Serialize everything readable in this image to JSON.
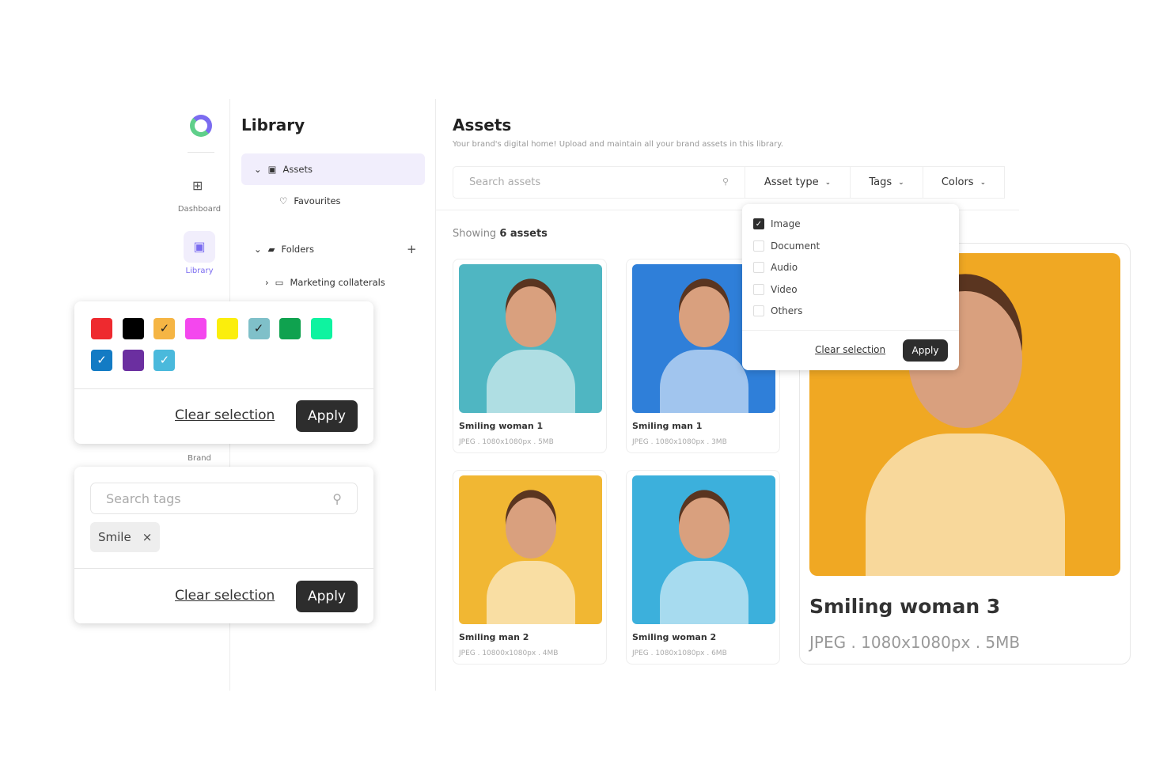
{
  "rail": {
    "items": [
      {
        "label": "Dashboard",
        "icon": "grid-icon"
      },
      {
        "label": "Library",
        "icon": "folder-image-icon",
        "active": true
      },
      {
        "label": "Brand"
      }
    ]
  },
  "library": {
    "title": "Library",
    "assets": "Assets",
    "favourites": "Favourites",
    "folders": "Folders",
    "marketing": "Marketing collaterals"
  },
  "main": {
    "title": "Assets",
    "subtitle": "Your brand's digital home! Upload and maintain all your brand assets in this library.",
    "search_placeholder": "Search assets",
    "filters": [
      "Asset type",
      "Tags",
      "Colors"
    ],
    "showing_prefix": "Showing",
    "showing_count": "6 assets"
  },
  "cards": [
    {
      "title": "Smiling woman 1",
      "meta": "JPEG . 1080x1080px . 5MB",
      "bg": "#4fb6c2"
    },
    {
      "title": "Smiling man 1",
      "meta": "JPEG . 1080x1080px . 3MB",
      "bg": "#2f7fd9"
    },
    {
      "title": "Smiling man 2",
      "meta": "JPEG . 10800x1080px . 4MB",
      "bg": "#f1b733"
    },
    {
      "title": "Smiling woman 2",
      "meta": "JPEG . 1080x1080px . 6MB",
      "bg": "#3cb0dc"
    }
  ],
  "preview": {
    "title": "Smiling woman 3",
    "meta": "JPEG . 1080x1080px . 5MB",
    "bg": "#f0a823"
  },
  "asset_type_dropdown": {
    "options": [
      {
        "label": "Image",
        "checked": true
      },
      {
        "label": "Document",
        "checked": false
      },
      {
        "label": "Audio",
        "checked": false
      },
      {
        "label": "Video",
        "checked": false
      },
      {
        "label": "Others",
        "checked": false
      }
    ],
    "clear": "Clear selection",
    "apply": "Apply"
  },
  "colors_popover": {
    "swatches": [
      {
        "color": "#ee2a2f",
        "checked": false
      },
      {
        "color": "#000000",
        "checked": false
      },
      {
        "color": "#f5b544",
        "checked": true
      },
      {
        "color": "#f447ee",
        "checked": false
      },
      {
        "color": "#fbee0c",
        "checked": false
      },
      {
        "color": "#7fc0c9",
        "checked": true
      },
      {
        "color": "#0fa24f",
        "checked": false
      },
      {
        "color": "#0ef3a0",
        "checked": false
      },
      {
        "color": "#137bc4",
        "checked": true
      },
      {
        "color": "#6b2fa0",
        "checked": false
      },
      {
        "color": "#4ab9dc",
        "checked": true
      }
    ],
    "clear": "Clear selection",
    "apply": "Apply"
  },
  "tags_popover": {
    "search_placeholder": "Search tags",
    "tags": [
      "Smile"
    ],
    "clear": "Clear selection",
    "apply": "Apply"
  }
}
